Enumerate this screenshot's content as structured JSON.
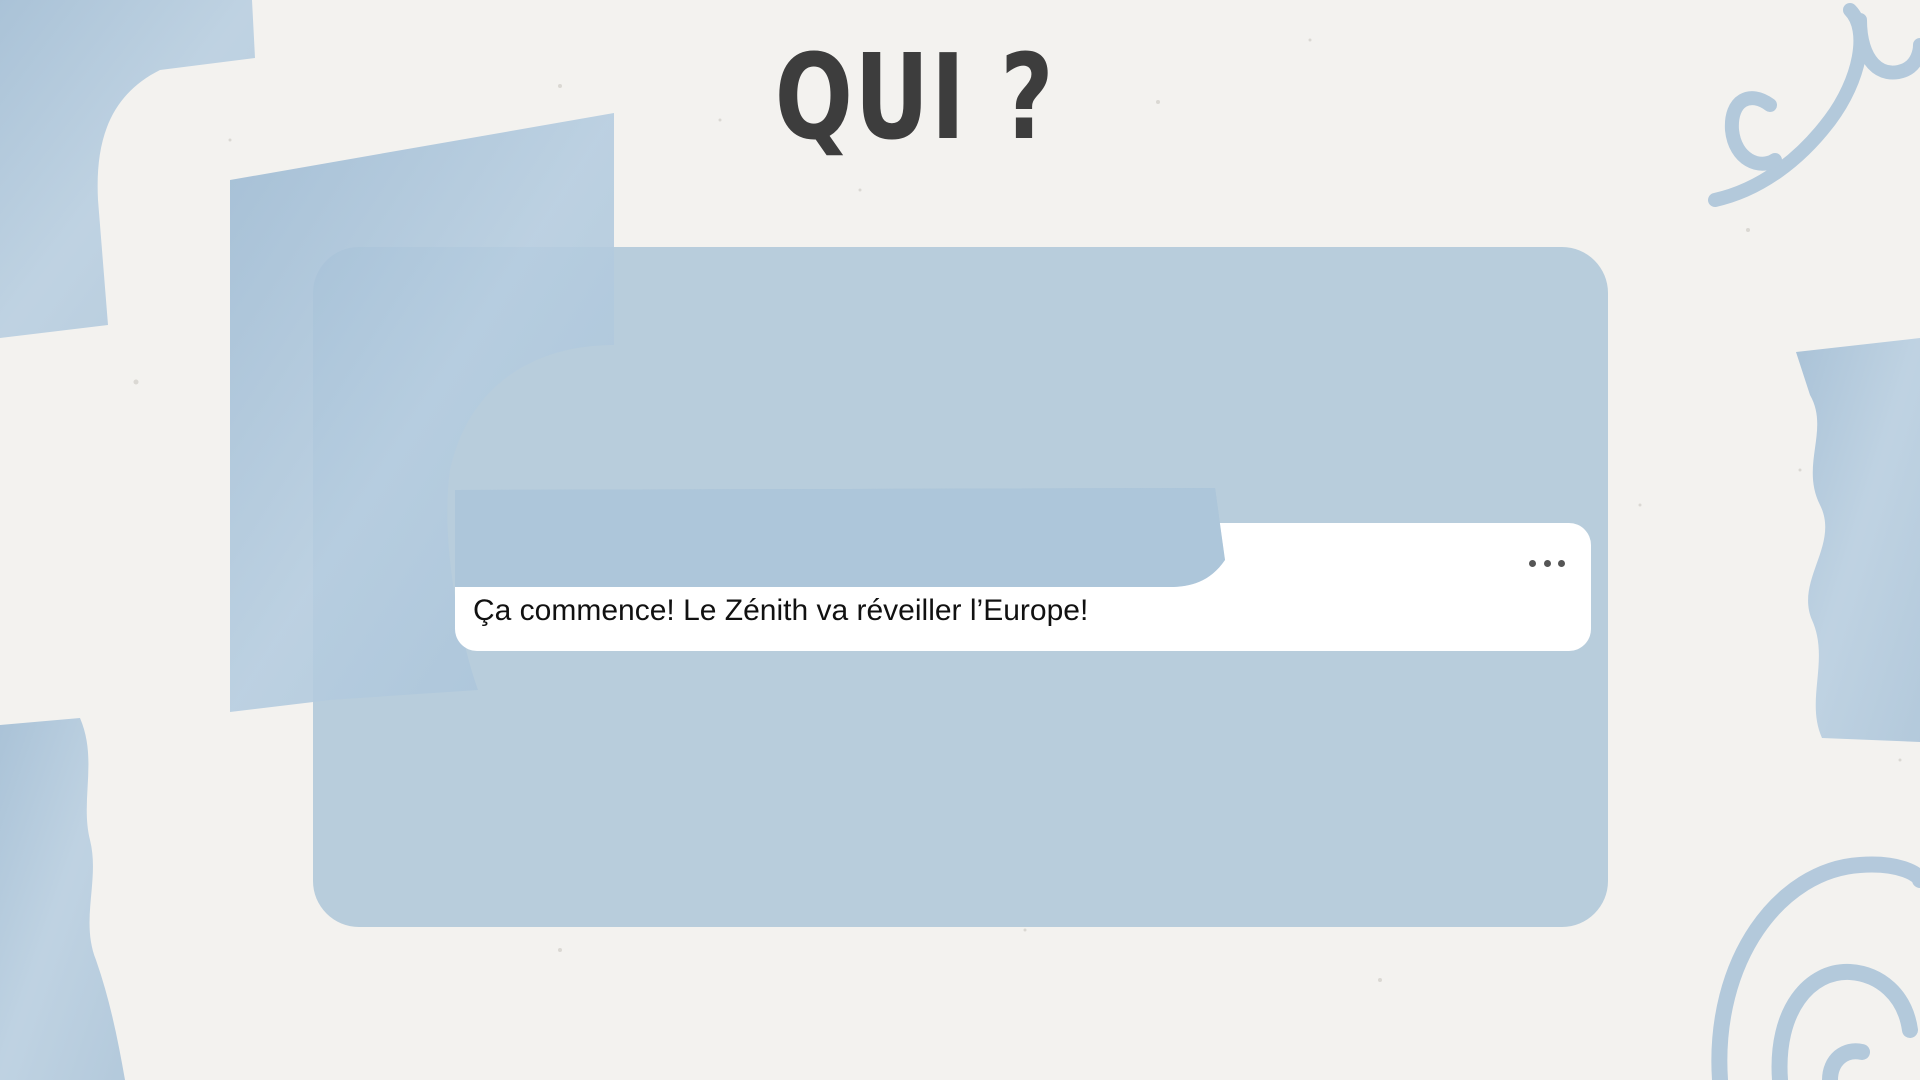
{
  "slide": {
    "title": "QUI ?"
  },
  "post": {
    "text": "Ça commence! Le Zénith va réveiller l’Europe!",
    "more_icon": "more-horizontal-icon"
  },
  "colors": {
    "background": "#f3f2ef",
    "card": "#b8cddc",
    "watercolor": "#a9c3d9",
    "title": "#3d3d3d",
    "post_bg": "#ffffff"
  }
}
